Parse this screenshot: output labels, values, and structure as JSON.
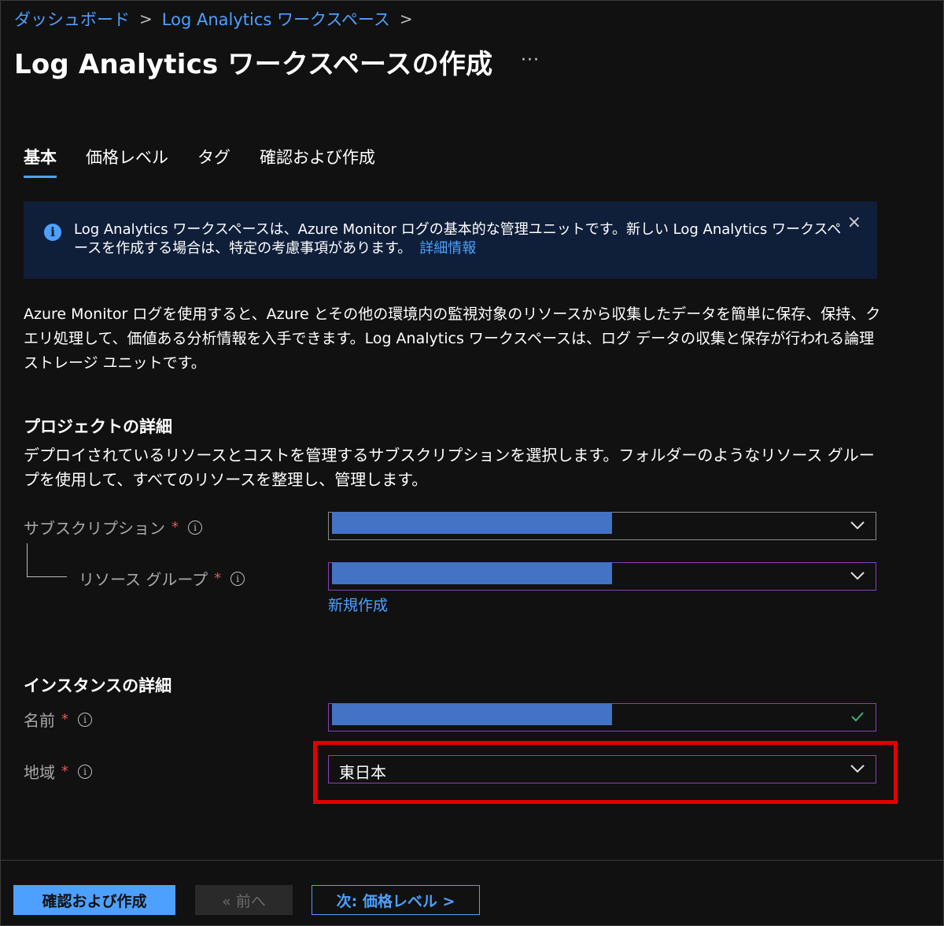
{
  "breadcrumb": {
    "items": [
      "ダッシュボード",
      "Log Analytics ワークスペース"
    ],
    "separator": ">"
  },
  "page": {
    "title": "Log Analytics ワークスペースの作成",
    "more_label": "···"
  },
  "tabs": [
    {
      "label": "基本",
      "active": true
    },
    {
      "label": "価格レベル",
      "active": false
    },
    {
      "label": "タグ",
      "active": false
    },
    {
      "label": "確認および作成",
      "active": false
    }
  ],
  "banner": {
    "icon": "info-icon",
    "text": "Log Analytics ワークスペースは、Azure Monitor ログの基本的な管理ユニットです。新しい Log Analytics ワークスペースを作成する場合は、特定の考慮事項があります。",
    "link": "詳細情報",
    "close_label": "×"
  },
  "description": "Azure Monitor ログを使用すると、Azure とその他の環境内の監視対象のリソースから収集したデータを簡単に保存、保持、クエリ処理して、価値ある分析情報を入手できます。Log Analytics ワークスペースは、ログ データの収集と保存が行われる論理ストレージ ユニットです。",
  "project": {
    "title": "プロジェクトの詳細",
    "description": "デプロイされているリソースとコストを管理するサブスクリプションを選択します。フォルダーのようなリソース グループを使用して、すべてのリソースを整理し、管理します。",
    "subscription": {
      "label": "サブスクリプション",
      "required": "*",
      "value": ""
    },
    "resource_group": {
      "label": "リソース グループ",
      "required": "*",
      "value": "",
      "new_link": "新規作成"
    }
  },
  "instance": {
    "title": "インスタンスの詳細",
    "name": {
      "label": "名前",
      "required": "*",
      "value": ""
    },
    "region": {
      "label": "地域",
      "required": "*",
      "value": "東日本"
    }
  },
  "footer": {
    "review_create": "確認および作成",
    "previous": "« 前へ",
    "next": "次: 価格レベル >"
  },
  "colors": {
    "background": "#111111",
    "accent": "#4ea0ff",
    "banner_bg": "#0f1f3a",
    "primary_button": "#4ea0ff",
    "field_border_purple": "#8a3fbf",
    "field_border_gray": "#8a8a8a",
    "highlight_red": "#e00000",
    "redaction": "#4472c4",
    "valid_check": "#3cb371"
  }
}
